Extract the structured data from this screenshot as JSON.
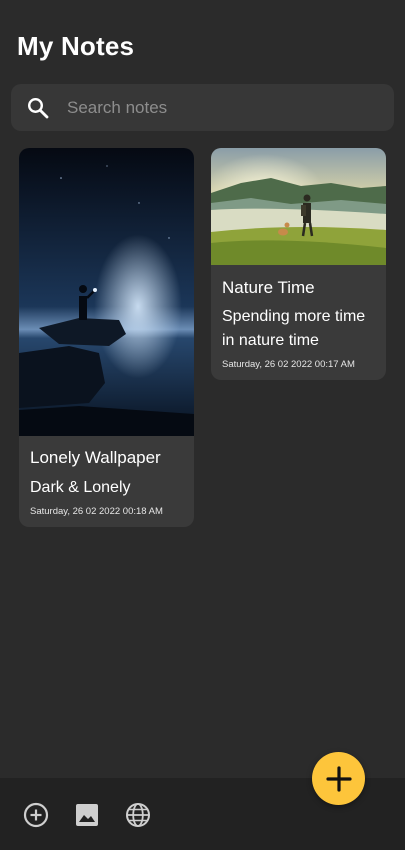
{
  "header": {
    "title": "My Notes"
  },
  "search": {
    "placeholder": "Search notes",
    "value": "",
    "icon": "search-icon"
  },
  "notes": [
    {
      "title": "Lonely Wallpaper",
      "subtitle": "Dark & Lonely",
      "date": "Saturday, 26 02 2022 00:18 AM",
      "image": "night-lake-silhouette-image"
    },
    {
      "title": "Nature Time",
      "subtitle": "Spending more time in nature time",
      "date": "Saturday, 26 02 2022 00:17 AM",
      "image": "hiker-lake-landscape-image"
    }
  ],
  "fab": {
    "icon": "plus-icon"
  },
  "bottom_bar": {
    "icons": [
      "add-circle-icon",
      "image-icon",
      "globe-icon"
    ]
  },
  "colors": {
    "background": "#2b2b2b",
    "search_bg": "#373737",
    "card_bg": "#3a3a3a",
    "accent": "#fdc53b",
    "bottom_bar": "#222222",
    "placeholder": "#8d8d8d"
  }
}
